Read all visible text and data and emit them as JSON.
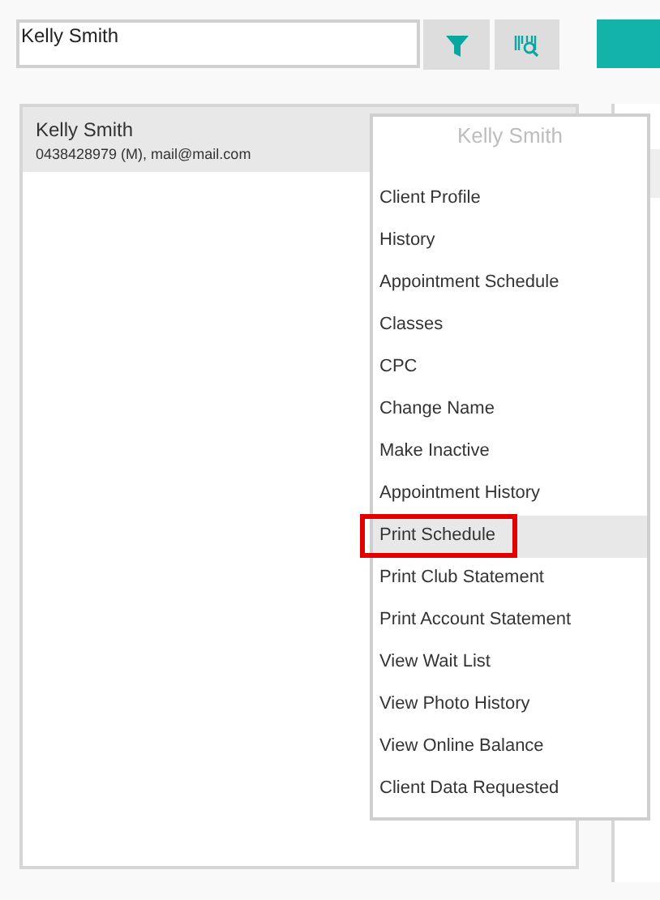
{
  "search": {
    "value": "Kelly Smith"
  },
  "client_list": [
    {
      "name": "Kelly Smith",
      "contact": "0438428979 (M), mail@mail.com",
      "selected": true
    }
  ],
  "context_menu": {
    "title": "Kelly Smith",
    "items": [
      {
        "label": "Client Profile",
        "selected": false,
        "annotated": false
      },
      {
        "label": "History",
        "selected": false,
        "annotated": false
      },
      {
        "label": "Appointment Schedule",
        "selected": false,
        "annotated": false
      },
      {
        "label": "Classes",
        "selected": false,
        "annotated": false
      },
      {
        "label": "CPC",
        "selected": false,
        "annotated": false
      },
      {
        "label": "Change Name",
        "selected": false,
        "annotated": false
      },
      {
        "label": "Make Inactive",
        "selected": false,
        "annotated": false
      },
      {
        "label": "Appointment History",
        "selected": false,
        "annotated": false
      },
      {
        "label": "Print Schedule",
        "selected": true,
        "annotated": true
      },
      {
        "label": "Print Club Statement",
        "selected": false,
        "annotated": false
      },
      {
        "label": "Print Account Statement",
        "selected": false,
        "annotated": false
      },
      {
        "label": "View Wait List",
        "selected": false,
        "annotated": false
      },
      {
        "label": "View Photo History",
        "selected": false,
        "annotated": false
      },
      {
        "label": "View Online Balance",
        "selected": false,
        "annotated": false
      },
      {
        "label": "Client Data Requested",
        "selected": false,
        "annotated": false
      }
    ]
  }
}
